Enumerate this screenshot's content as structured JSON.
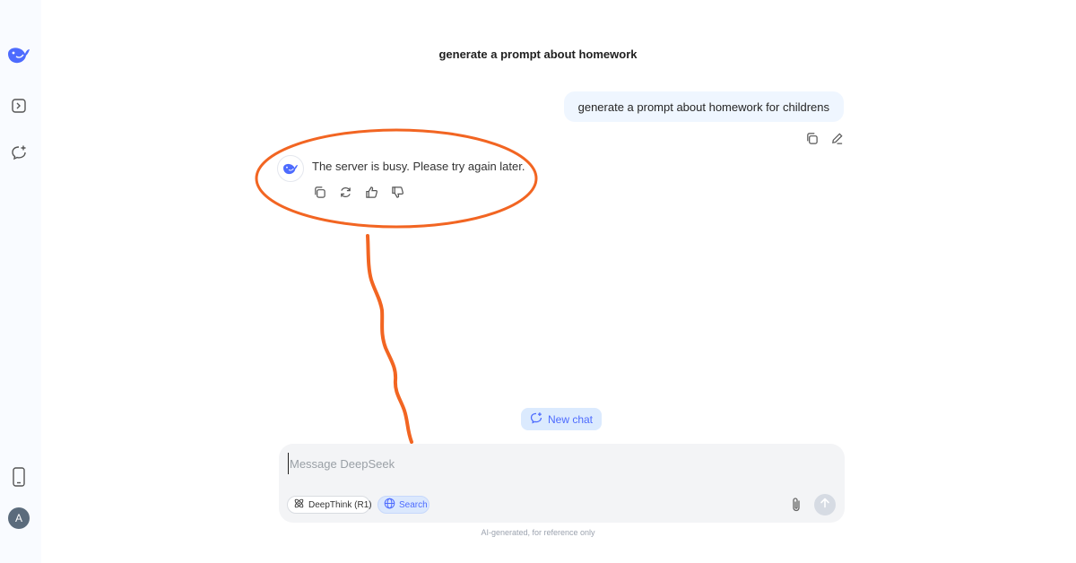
{
  "chat": {
    "title": "generate a prompt about homework",
    "user_message": "generate a prompt about homework for childrens",
    "bot_message": "The server is busy. Please try again later."
  },
  "sidebar": {
    "avatar_letter": "A",
    "items": [
      {
        "icon": "deepseek-logo-icon"
      },
      {
        "icon": "open-sidebar-icon"
      },
      {
        "icon": "new-chat-icon"
      },
      {
        "icon": "mobile-app-icon"
      }
    ]
  },
  "new_chat_label": "New chat",
  "composer": {
    "placeholder": "Message DeepSeek",
    "deepthink_label": "DeepThink (R1)",
    "search_label": "Search"
  },
  "disclaimer": "AI-generated, for reference only",
  "colors": {
    "accent": "#4d6bfe",
    "annotation": "#f26522",
    "user_bubble": "#eff6ff"
  }
}
